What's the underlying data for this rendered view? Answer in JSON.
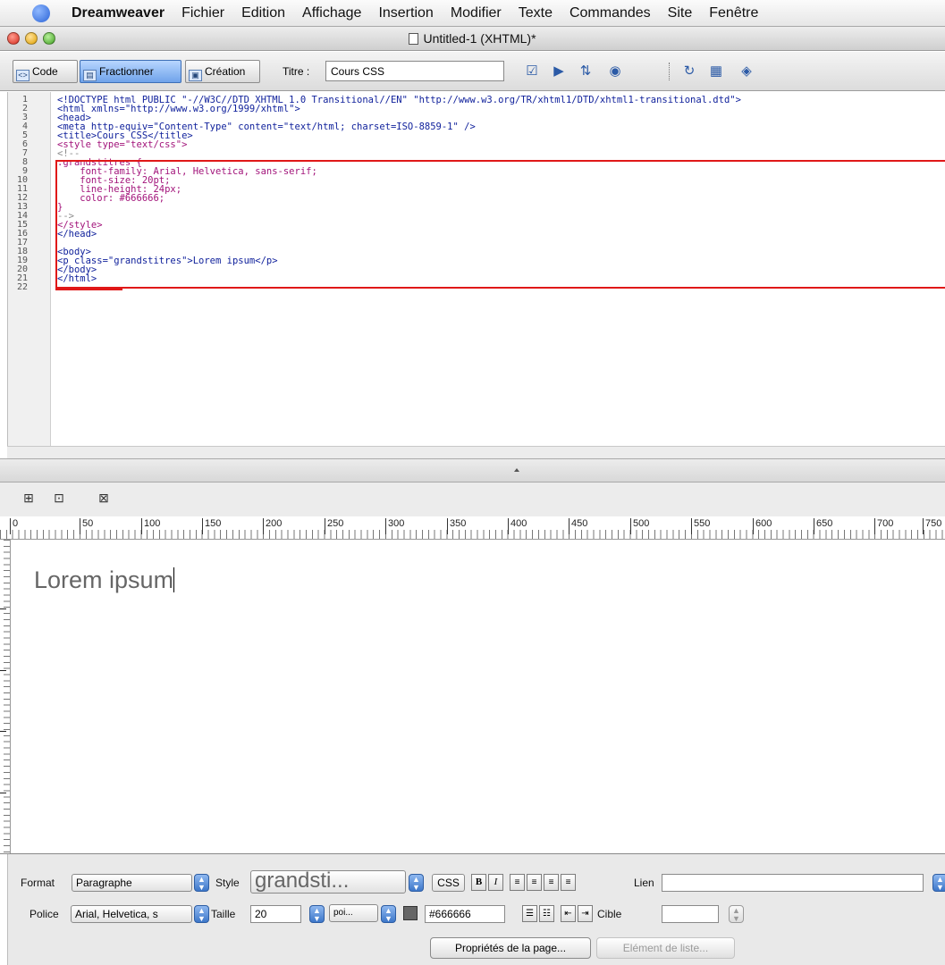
{
  "menubar": {
    "app_name": "Dreamweaver",
    "items": [
      "Fichier",
      "Edition",
      "Affichage",
      "Insertion",
      "Modifier",
      "Texte",
      "Commandes",
      "Site",
      "Fenêtre"
    ]
  },
  "window": {
    "title": "Untitled-1 (XHTML)*"
  },
  "doc_toolbar": {
    "code_label": "Code",
    "split_label": "Fractionner",
    "design_label": "Création",
    "title_label": "Titre :",
    "title_value": "Cours CSS",
    "icons": [
      "validate-markup-icon",
      "check-browser-icon",
      "file-management-icon",
      "preview-browser-icon",
      "refresh-icon",
      "view-options-icon",
      "visual-aids-icon"
    ]
  },
  "code": {
    "line_numbers": [
      "1",
      "2",
      "3",
      "4",
      "5",
      "6",
      "7",
      "8",
      "9",
      "10",
      "11",
      "12",
      "13",
      "14",
      "15",
      "16",
      "17",
      "18",
      "19",
      "20",
      "21",
      "22"
    ],
    "lines": [
      "<!DOCTYPE html PUBLIC \"-//W3C//DTD XHTML 1.0 Transitional//EN\" \"http://www.w3.org/TR/xhtml1/DTD/xhtml1-transitional.dtd\">",
      "<html xmlns=\"http://www.w3.org/1999/xhtml\">",
      "<head>",
      "<meta http-equiv=\"Content-Type\" content=\"text/html; charset=ISO-8859-1\" />",
      "<title>Cours CSS</title>",
      "<style type=\"text/css\">",
      "<!--",
      ".grandstitres {",
      "    font-family: Arial, Helvetica, sans-serif;",
      "    font-size: 20pt;",
      "    line-height: 24px;",
      "    color: #666666;",
      "}",
      "-->",
      "</style>",
      "</head>",
      "",
      "<body>",
      "<p class=\"grandstitres\">Lorem ipsum</p>",
      "</body>",
      "</html>",
      ""
    ]
  },
  "ruler": {
    "h_labels": [
      "0",
      "50",
      "100",
      "150",
      "200",
      "250",
      "300",
      "350",
      "400",
      "450",
      "500",
      "550",
      "600",
      "650",
      "700",
      "750"
    ]
  },
  "design": {
    "text": "Lorem ipsum",
    "text_color": "#666666"
  },
  "inspector": {
    "format_label": "Format",
    "format_value": "Paragraphe",
    "style_label": "Style",
    "style_value": "grandsti...",
    "css_label": "CSS",
    "bold_label": "B",
    "italic_label": "I",
    "link_label": "Lien",
    "link_value": "",
    "font_label": "Police",
    "font_value": "Arial, Helvetica, s",
    "size_label": "Taille",
    "size_value": "20",
    "unit_value": "poi...",
    "color_value": "#666666",
    "target_label": "Cible",
    "target_value": "",
    "page_props_label": "Propriétés de la page...",
    "list_item_label": "Elément de liste..."
  },
  "colors": {
    "highlight": "#e01818",
    "tag": "#11229c",
    "css": "#a2137a",
    "comment": "#8c8c8c",
    "split_button": "#6fa3ea"
  }
}
